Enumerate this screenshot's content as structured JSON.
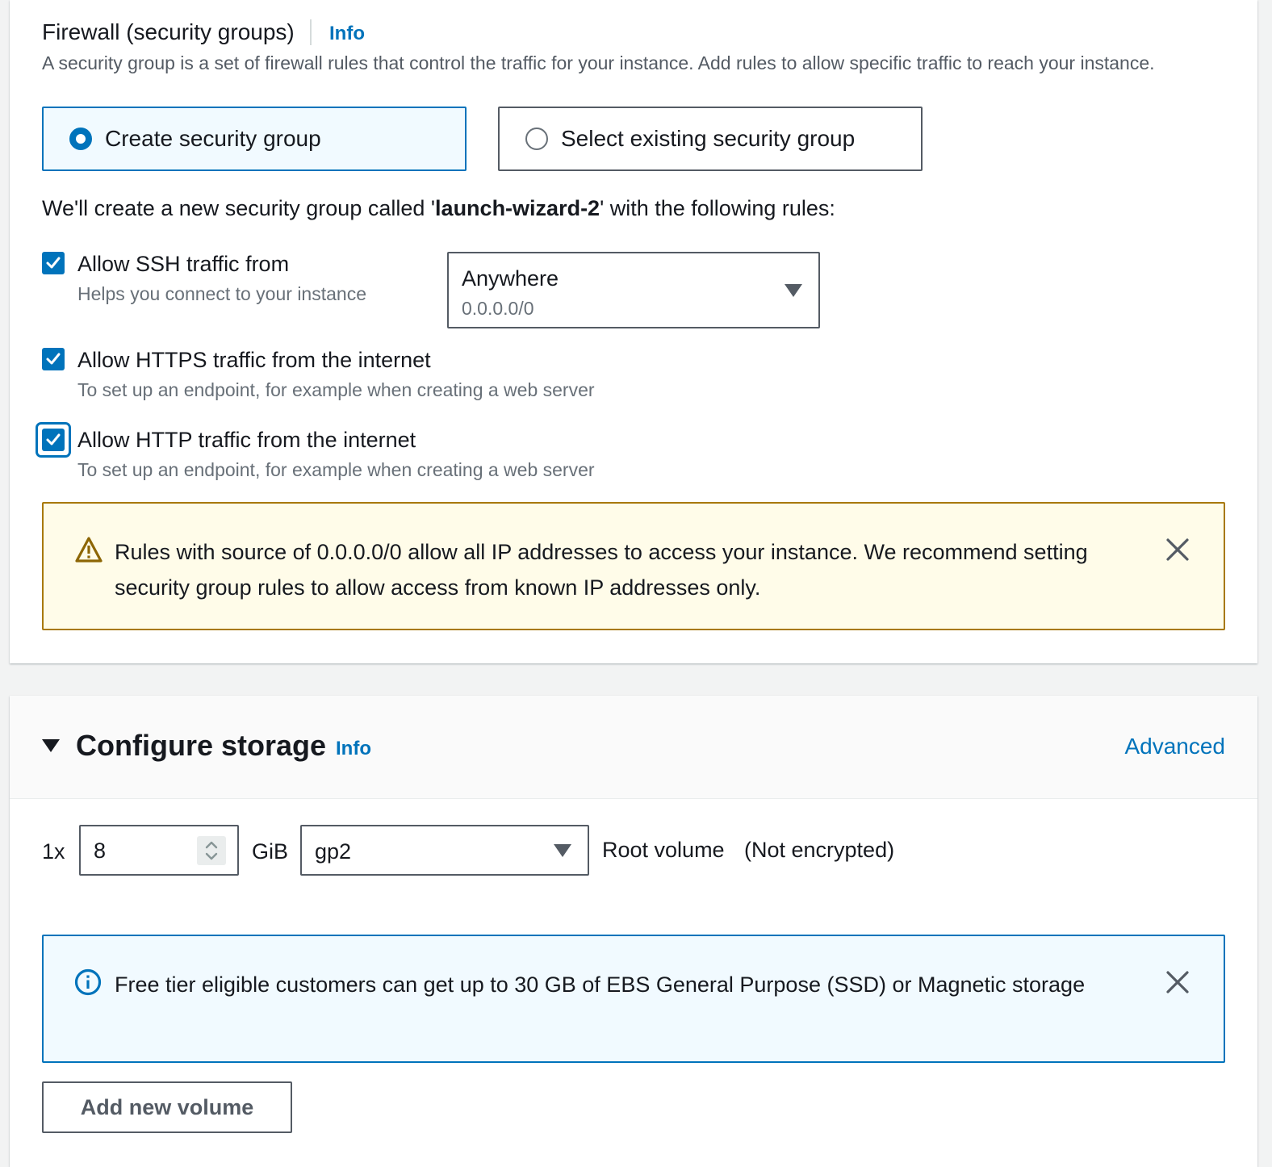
{
  "firewall": {
    "title": "Firewall (security groups)",
    "info_label": "Info",
    "description": "A security group is a set of firewall rules that control the traffic for your instance. Add rules to allow specific traffic to reach your instance.",
    "options": {
      "create": "Create security group",
      "existing": "Select existing security group"
    },
    "selected_option": "create",
    "note_prefix": "We'll create a new security group called '",
    "group_name": "launch-wizard-2",
    "note_suffix": "' with the following rules:",
    "rules": {
      "ssh": {
        "label": "Allow SSH traffic from",
        "description": "Helps you connect to your instance",
        "checked": true,
        "source_label": "Anywhere",
        "source_value": "0.0.0.0/0"
      },
      "https": {
        "label": "Allow HTTPS traffic from the internet",
        "description": "To set up an endpoint, for example when creating a web server",
        "checked": true
      },
      "http": {
        "label": "Allow HTTP traffic from the internet",
        "description": "To set up an endpoint, for example when creating a web server",
        "checked": true
      }
    },
    "warning": "Rules with source of 0.0.0.0/0 allow all IP addresses to access your instance. We recommend setting security group rules to allow access from known IP addresses only."
  },
  "storage": {
    "title": "Configure storage",
    "info_label": "Info",
    "advanced_label": "Advanced",
    "count_label": "1x",
    "size_value": "8",
    "size_unit": "GiB",
    "volume_type": "gp2",
    "root_label": "Root volume",
    "encryption_label": "(Not encrypted)",
    "free_tier_notice": "Free tier eligible customers can get up to 30 GB of EBS General Purpose (SSD) or Magnetic storage",
    "add_volume_label": "Add new volume"
  },
  "colors": {
    "accent": "#0073bb",
    "warning_border": "#a8790a",
    "warning_bg": "#fffce9",
    "info_bg": "#f1faff"
  }
}
